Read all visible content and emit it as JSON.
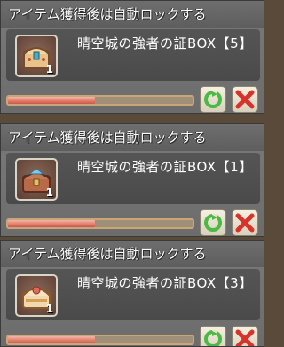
{
  "panels": [
    {
      "header": "アイテム獲得後は自動ロックする",
      "item_name": "晴空城の強者の証BOX【5】",
      "count": "1",
      "progress": 0.47,
      "chest_color": "#e8c48a"
    },
    {
      "header": "アイテム獲得後は自動ロックする",
      "item_name": "晴空城の強者の証BOX【1】",
      "count": "1",
      "progress": 0.47,
      "chest_color": "#b86a48"
    },
    {
      "header": "アイテム獲得後は自動ロックする",
      "item_name": "晴空城の強者の証BOX【3】",
      "count": "1",
      "progress": 0.47,
      "chest_color": "#f0d8b0"
    }
  ],
  "icons": {
    "lock": "lock-toggle-icon",
    "close": "close-icon",
    "item": "treasure-chest-icon"
  },
  "colors": {
    "progress_fill": "#e07a6a",
    "lock_green": "#4cb846",
    "close_red": "#d8322a"
  }
}
